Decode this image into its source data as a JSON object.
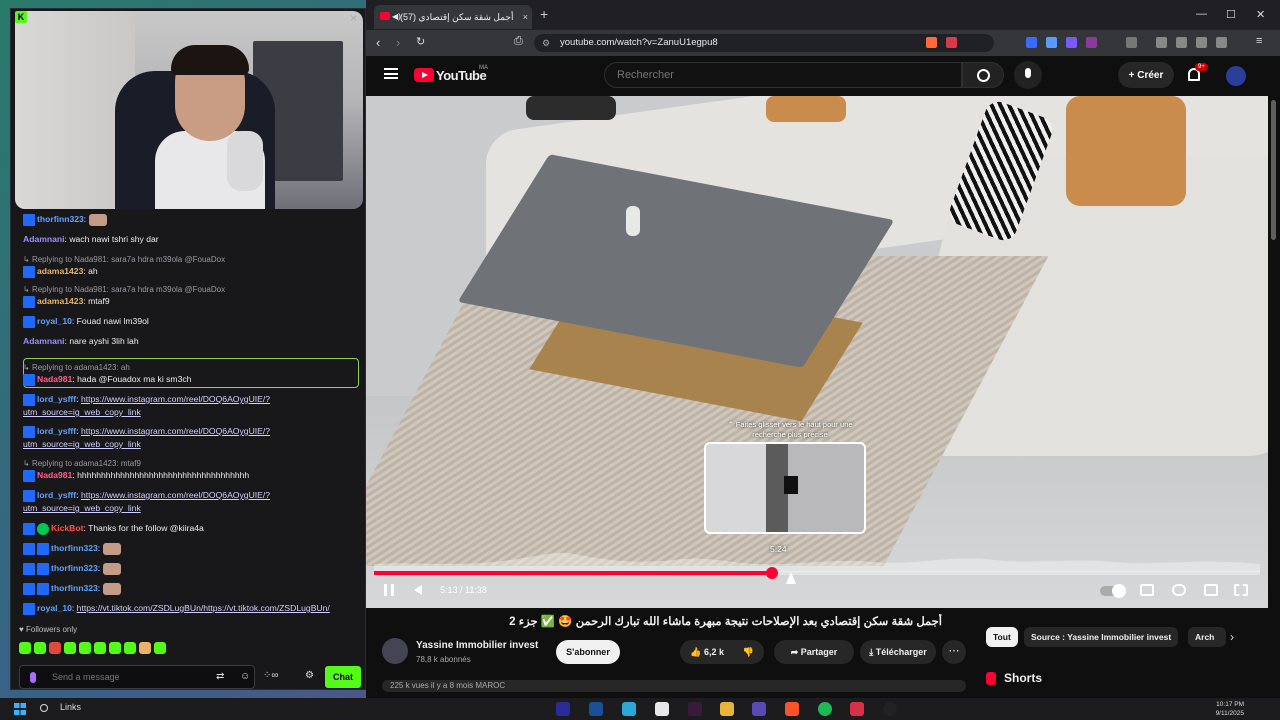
{
  "chat": {
    "messages": [
      {
        "user": "thorfinn323",
        "color": "blue",
        "text": ""
      },
      {
        "user": "Adamnani",
        "color": "lav",
        "text": ": wach nawi tshri shy dar"
      },
      {
        "reply": "Replying to Nada981: sara7a hdra m39ola @FouaDox"
      },
      {
        "user": "adama1423",
        "color": "gold",
        "text": ": ah"
      },
      {
        "reply": "Replying to Nada981: sara7a hdra m39ola @FouaDox"
      },
      {
        "user": "adama1423",
        "color": "gold",
        "text": ": mtaf9"
      },
      {
        "user": "royal_10",
        "color": "blue",
        "text": ": Fouad nawi lm39ol"
      },
      {
        "user": "Adamnani",
        "color": "lav",
        "text": ": nare ayshi 3lih lah"
      },
      {
        "reply": "Replying to adama1423: ah"
      },
      {
        "user": "Nada981",
        "color": "pink",
        "text": ": hada @Fouadox ma ki sm3ch"
      },
      {
        "user": "lord_ysfff",
        "color": "blue",
        "link": "https://www.instagram.com/reel/DOQ6AOygUIE/?utm_source=ig_web_copy_link"
      },
      {
        "user": "lord_ysfff",
        "color": "blue",
        "link": "https://www.instagram.com/reel/DOQ6AOygUIE/?utm_source=ig_web_copy_link"
      },
      {
        "reply": "Replying to adama1423: mtaf9"
      },
      {
        "user": "Nada981",
        "color": "pink",
        "text": ": hhhhhhhhhhhhhhhhhhhhhhhhhhhhhhhhhhhh"
      },
      {
        "user": "lord_ysfff",
        "color": "blue",
        "link": "https://www.instagram.com/reel/DOQ6AOygUIE/?utm_source=ig_web_copy_link"
      },
      {
        "user": "KickBot",
        "color": "red",
        "text": ": Thanks for the follow @kiira4a"
      },
      {
        "user": "thorfinn323",
        "color": "blue",
        "text": ""
      },
      {
        "user": "thorfinn323",
        "color": "blue",
        "text": ""
      },
      {
        "user": "thorfinn323",
        "color": "blue",
        "text": ""
      },
      {
        "user": "royal_10",
        "color": "blue",
        "link": "https://vt.tiktok.com/ZSDLugBUn/https://vt.tiktok.com/ZSDLugBUn/"
      }
    ],
    "followers_only": "Followers only",
    "input_placeholder": "Send a message",
    "send_label": "Chat"
  },
  "browser": {
    "tab_title": "(57) أجمل شقة سكن إقتصادي",
    "url": "youtube.com/watch?v=ZanuU1egpu8"
  },
  "youtube": {
    "logo_text": "YouTube",
    "region": "MA",
    "search_placeholder": "Rechercher",
    "create_label": "Créer",
    "notif_count": "9+",
    "hint_text": "⌃ Faites glisser vers le haut pour une recherche plus précise",
    "preview_time": "5:24",
    "time_display": "5:13 / 11:38",
    "progress_fraction": 0.449,
    "title": "أجمل شقة سكن إقتصادي بعد الإصلاحات نتيجة مبهرة ماشاء الله تبارك الرحمن 🤩 ✅ جزء 2",
    "channel_name": "Yassine Immobilier invest",
    "subscribers": "78,8 k abonnés",
    "subscribe_label": "S'abonner",
    "likes": "6,2 k",
    "share_label": "Partager",
    "download_label": "Télécharger",
    "desc_peek": "225 k vues il y a 8 mois  MAROC",
    "chips": [
      "Tout",
      "Source : Yassine Immobilier invest",
      "Arch"
    ],
    "shorts_label": "Shorts"
  },
  "taskbar": {
    "search_label": "Links",
    "time": "10:17 PM",
    "date": "9/11/2025"
  },
  "colors": {
    "kick_green": "#53fc18",
    "yt_red": "#ff0033"
  }
}
